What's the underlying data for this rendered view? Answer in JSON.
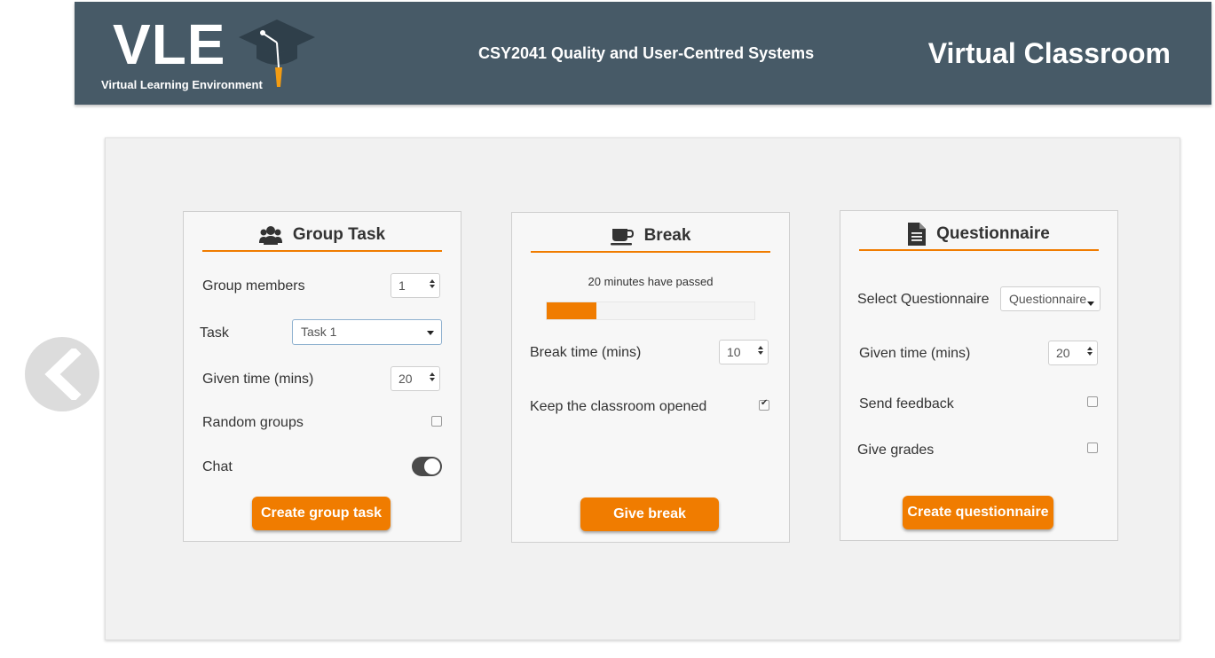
{
  "header": {
    "logo_text": "VLE",
    "logo_subtitle": "Virtual Learning Environment",
    "course": "CSY2041 Quality and User-Centred Systems",
    "page_title": "Virtual Classroom"
  },
  "group_task": {
    "title": "Group Task",
    "icon": "users-icon",
    "members_label": "Group members",
    "members_value": "1",
    "task_label": "Task",
    "task_value": "Task 1",
    "time_label": "Given time (mins)",
    "time_value": "20",
    "random_label": "Random groups",
    "random_checked": false,
    "chat_label": "Chat",
    "chat_on": true,
    "button": "Create group task"
  },
  "break": {
    "title": "Break",
    "icon": "coffee-cup-icon",
    "progress_text": "20 minutes have passed",
    "progress_fraction": 0.24,
    "time_label": "Break time (mins)",
    "time_value": "10",
    "keep_open_label": "Keep the classroom opened",
    "keep_open_checked": true,
    "button": "Give break"
  },
  "questionnaire": {
    "title": "Questionnaire",
    "icon": "document-icon",
    "select_label": "Select Questionnaire",
    "select_value": "Questionnaire",
    "time_label": "Given time (mins)",
    "time_value": "20",
    "feedback_label": "Send feedback",
    "feedback_checked": false,
    "grades_label": "Give grades",
    "grades_checked": false,
    "button": "Create questionnaire"
  },
  "colors": {
    "header_bg": "#475a67",
    "accent": "#f07c00",
    "panel_bg": "#f1f1f1"
  }
}
